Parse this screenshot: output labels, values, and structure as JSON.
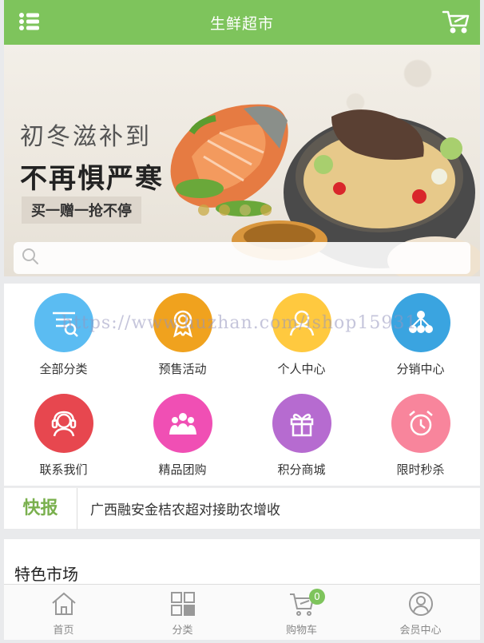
{
  "header": {
    "title": "生鲜超市"
  },
  "banner": {
    "line1": "初冬滋补到",
    "line2": "不再惧严寒",
    "tag": "买一赠一抢不停",
    "dot_count": 4,
    "active_dot": 2
  },
  "search": {
    "placeholder": ""
  },
  "watermark": "https://www.huzhan.com/ishop15931",
  "nav": {
    "items": [
      {
        "label": "全部分类",
        "icon": "list-icon",
        "color": "#5bbcf2"
      },
      {
        "label": "预售活动",
        "icon": "award-icon",
        "color": "#f0a21e"
      },
      {
        "label": "个人中心",
        "icon": "user-icon",
        "color": "#ffc93f"
      },
      {
        "label": "分销中心",
        "icon": "share-icon",
        "color": "#3aa4e0"
      },
      {
        "label": "联系我们",
        "icon": "headset-icon",
        "color": "#e7474f"
      },
      {
        "label": "精品团购",
        "icon": "group-icon",
        "color": "#f04fb4"
      },
      {
        "label": "积分商城",
        "icon": "gift-icon",
        "color": "#b66bd0"
      },
      {
        "label": "限时秒杀",
        "icon": "alarm-icon",
        "color": "#f8859c"
      }
    ]
  },
  "news": {
    "tag": "快报",
    "text": "广西融安金桔农超对接助农增收"
  },
  "featured": {
    "title": "特色市场"
  },
  "tabbar": {
    "items": [
      {
        "label": "首页",
        "icon": "home-icon"
      },
      {
        "label": "分类",
        "icon": "category-icon"
      },
      {
        "label": "购物车",
        "icon": "cart-icon",
        "badge": "0"
      },
      {
        "label": "会员中心",
        "icon": "member-icon"
      }
    ]
  }
}
